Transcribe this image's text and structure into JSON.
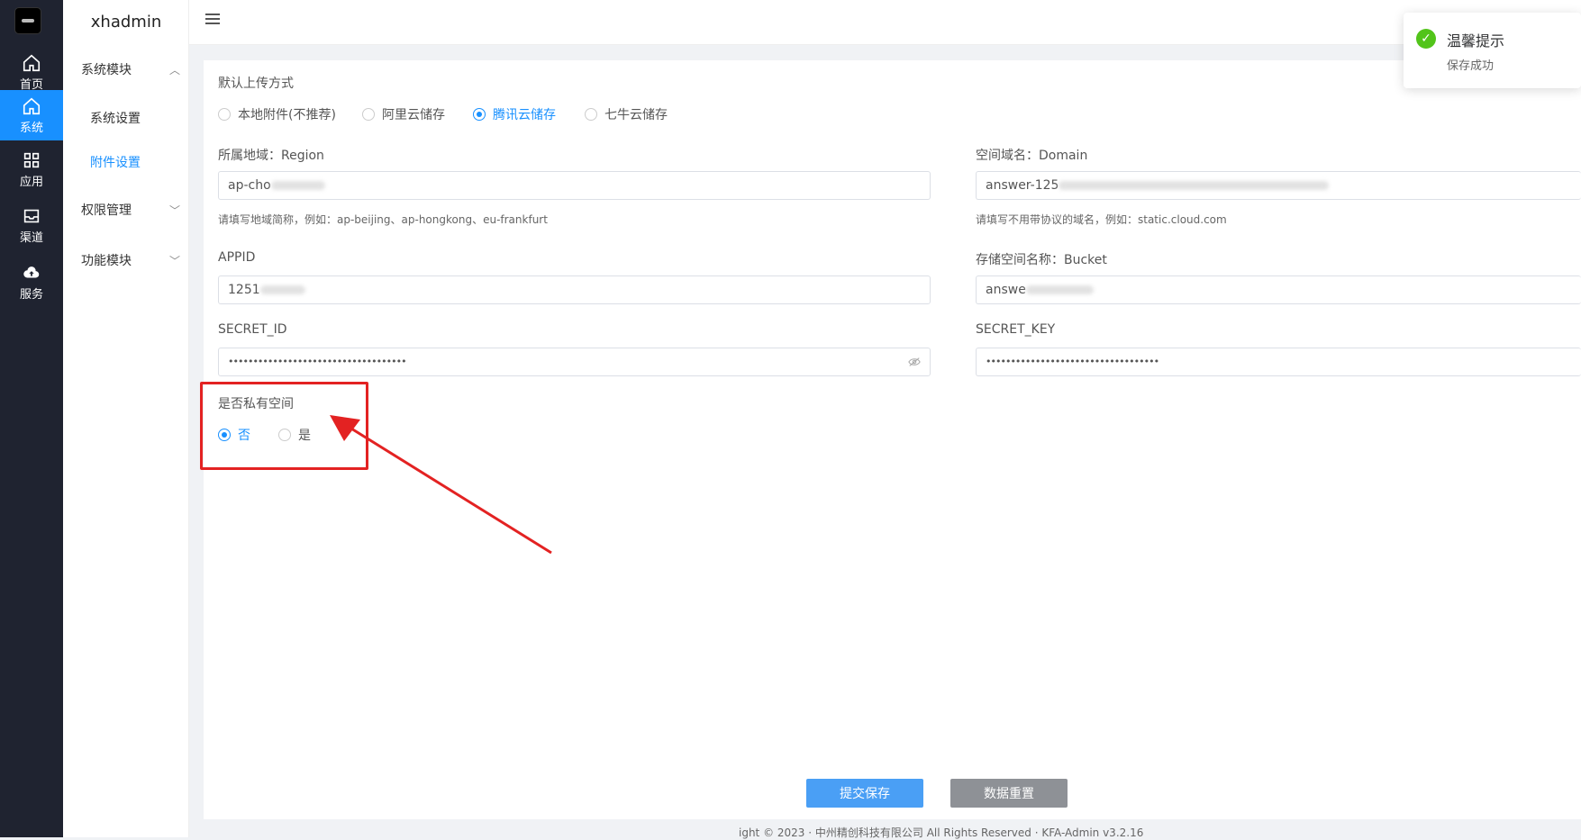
{
  "rail": {
    "items": [
      {
        "label": "首页",
        "icon": "home-icon"
      },
      {
        "label": "系统",
        "icon": "home-icon"
      },
      {
        "label": "应用",
        "icon": "grid-icon"
      },
      {
        "label": "渠道",
        "icon": "inbox-icon"
      },
      {
        "label": "服务",
        "icon": "cloud-upload-icon"
      }
    ],
    "active_color": "#1890ff"
  },
  "sidebar": {
    "title": "xhadmin",
    "groups": [
      {
        "label": "系统模块",
        "expanded": true
      },
      {
        "label": "权限管理",
        "expanded": false
      },
      {
        "label": "功能模块",
        "expanded": false
      }
    ],
    "subitems": [
      {
        "label": "系统设置"
      },
      {
        "label": "附件设置"
      }
    ]
  },
  "form": {
    "upload_method_label": "默认上传方式",
    "upload_options": [
      "本地附件(不推荐)",
      "阿里云储存",
      "腾讯云储存",
      "七牛云储存"
    ],
    "upload_selected": "腾讯云储存",
    "region_label": "所属地域：Region",
    "region_value": "ap-cho",
    "region_hint": "请填写地域简称，例如：ap-beijing、ap-hongkong、eu-frankfurt",
    "domain_label": "空间域名：Domain",
    "domain_value": "answer-125",
    "domain_hint": "请填写不用带协议的域名，例如：static.cloud.com",
    "appid_label": "APPID",
    "appid_value": "1251",
    "bucket_label": "存储空间名称：Bucket",
    "bucket_value": "answe",
    "secret_id_label": "SECRET_ID",
    "secret_id_value": "••••••••••••••••••••••••••••••••••••",
    "secret_key_label": "SECRET_KEY",
    "secret_key_value": "•••••••••••••••••••••••••••••••••••",
    "private_label": "是否私有空间",
    "private_options": [
      "否",
      "是"
    ],
    "private_selected": "否",
    "submit_label": "提交保存",
    "reset_label": "数据重置"
  },
  "footer": {
    "text": "ight © 2023 · 中州精创科技有限公司 All Rights Reserved · KFA-Admin v3.2.16"
  },
  "toast": {
    "title": "温馨提示",
    "message": "保存成功",
    "color": "#52c41a"
  },
  "annotation_color": "#e32222"
}
